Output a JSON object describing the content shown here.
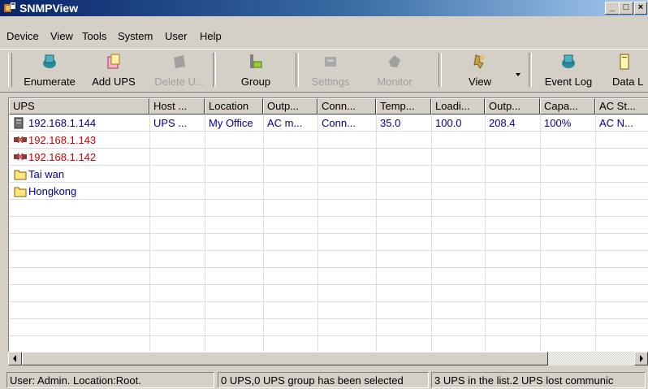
{
  "window": {
    "title": "SNMPView",
    "minimize": "_",
    "restore": "□",
    "close": "×"
  },
  "menu": [
    "Device",
    "View",
    "Tools",
    "System",
    "User",
    "Help"
  ],
  "toolbar": {
    "buttons": [
      {
        "label": "Enumerate",
        "icon": "network-enumerate-icon",
        "enabled": true
      },
      {
        "label": "Add UPS",
        "icon": "add-ups-icon",
        "enabled": true
      },
      {
        "label": "Delete U...",
        "icon": "delete-ups-icon",
        "enabled": false
      },
      {
        "label": "Group",
        "icon": "group-icon",
        "enabled": true
      },
      {
        "label": "Settings",
        "icon": "settings-icon",
        "enabled": false
      },
      {
        "label": "Monitor",
        "icon": "monitor-icon",
        "enabled": false
      },
      {
        "label": "View",
        "icon": "view-icon",
        "enabled": true
      },
      {
        "label": "Event Log",
        "icon": "event-log-icon",
        "enabled": true
      },
      {
        "label": "Data L",
        "icon": "data-log-icon",
        "enabled": true
      }
    ]
  },
  "table": {
    "columns": [
      "UPS",
      "Host ...",
      "Location",
      "Outp...",
      "Conn...",
      "Temp...",
      "Loadi...",
      "Outp...",
      "Capa...",
      "AC St..."
    ],
    "rows": [
      {
        "icon": "ups-device-icon",
        "status": "ok",
        "cells": [
          "192.168.1.144",
          "UPS ...",
          "My Office",
          "AC m...",
          "Conn...",
          "35.0",
          "100.0",
          "208.4",
          "100%",
          "AC N..."
        ]
      },
      {
        "icon": "lost-connection-icon",
        "status": "lost",
        "cells": [
          "192.168.1.143",
          "",
          "",
          "",
          "",
          "",
          "",
          "",
          "",
          ""
        ]
      },
      {
        "icon": "lost-connection-icon",
        "status": "lost",
        "cells": [
          "192.168.1.142",
          "",
          "",
          "",
          "",
          "",
          "",
          "",
          "",
          ""
        ]
      },
      {
        "icon": "folder-icon",
        "status": "group",
        "cells": [
          "Tai wan",
          "",
          "",
          "",
          "",
          "",
          "",
          "",
          "",
          ""
        ]
      },
      {
        "icon": "folder-icon",
        "status": "group",
        "cells": [
          "Hongkong",
          "",
          "",
          "",
          "",
          "",
          "",
          "",
          "",
          ""
        ]
      }
    ]
  },
  "status": {
    "user": "User: Admin.  Location:Root.",
    "selection": "0 UPS,0 UPS group has been selected",
    "summary": "3 UPS in the list.2 UPS  lost communic"
  },
  "colors": {
    "ok_text": "#00008b",
    "lost_text": "#cc0000",
    "folder": "#ffe680"
  }
}
